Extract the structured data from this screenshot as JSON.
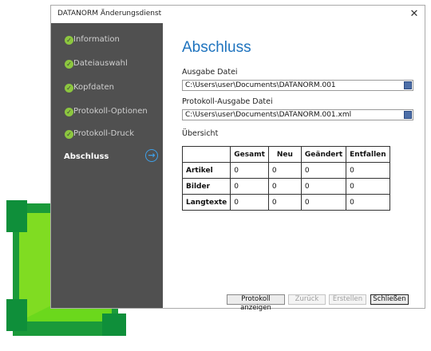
{
  "window": {
    "title": "DATANORM Änderungsdienst",
    "close_label": "✕"
  },
  "sidebar": {
    "items": [
      {
        "label": "Information",
        "done": true
      },
      {
        "label": "Dateiauswahl",
        "done": true
      },
      {
        "label": "Kopfdaten",
        "done": true
      },
      {
        "label": "Protokoll-Optionen",
        "done": true
      },
      {
        "label": "Protokoll-Druck",
        "done": true
      },
      {
        "label": "Abschluss",
        "done": false,
        "active": true
      }
    ]
  },
  "main": {
    "heading": "Abschluss",
    "output_file_label": "Ausgabe Datei",
    "output_file_value": "C:\\Users\\user\\Documents\\DATANORM.001",
    "protocol_file_label": "Protokoll-Ausgabe Datei",
    "protocol_file_value": "C:\\Users\\user\\Documents\\DATANORM.001.xml",
    "overview_label": "Übersicht",
    "table": {
      "headers": [
        "",
        "Gesamt",
        "Neu",
        "Geändert",
        "Entfallen"
      ],
      "rows": [
        {
          "name": "Artikel",
          "values": [
            "0",
            "0",
            "0",
            "0"
          ]
        },
        {
          "name": "Bilder",
          "values": [
            "0",
            "0",
            "0",
            "0"
          ]
        },
        {
          "name": "Langtexte",
          "values": [
            "0",
            "0",
            "0",
            "0"
          ]
        }
      ]
    }
  },
  "footer": {
    "show_protocol": "Protokoll anzeigen",
    "back": "Zurück",
    "create": "Erstellen",
    "close": "Schließen"
  },
  "colors": {
    "accent": "#1e73be",
    "sidebar": "#505050",
    "check": "#8cc63f",
    "logo_green": "#4ecf1b"
  }
}
